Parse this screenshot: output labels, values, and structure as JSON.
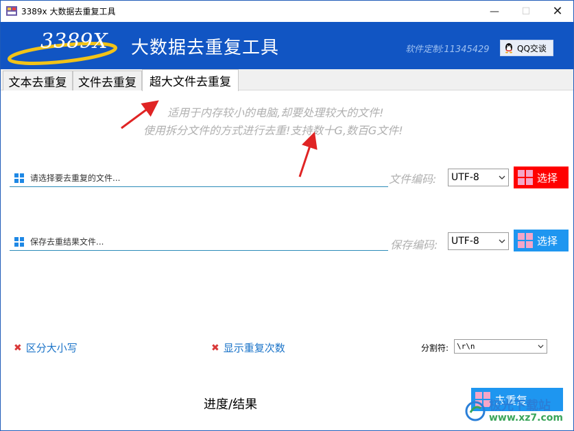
{
  "window": {
    "title": "3389x 大数据去重复工具",
    "minimize_glyph": "—",
    "maximize_glyph": "☐",
    "close_glyph": "✕"
  },
  "header": {
    "logo_text": "3389X",
    "app_title": "大数据去重复工具",
    "custom_text": "软件定制:11345429",
    "qq_button": "QQ交谈"
  },
  "tabs": [
    {
      "label": "文本去重复",
      "active": false
    },
    {
      "label": "文件去重复",
      "active": false
    },
    {
      "label": "超大文件去重复",
      "active": true
    }
  ],
  "notice": {
    "line1": "适用于内存较小的电脑,却要处理较大的文件!",
    "line2": "使用拆分文件的方式进行去重!支持数十G,数百G文件!"
  },
  "source_file": {
    "placeholder": "请选择要去重复的文件...",
    "encoding_label": "文件编码:",
    "encoding_value": "UTF-8",
    "pick_button": "选择",
    "button_color": "#ff0000"
  },
  "output_file": {
    "placeholder": "保存去重结果文件...",
    "encoding_label": "保存编码:",
    "encoding_value": "UTF-8",
    "pick_button": "选择",
    "button_color": "#1e96f0"
  },
  "options": {
    "case_sensitive": "区分大小写",
    "show_repeat_count": "显示重复次数",
    "separator_label": "分割符:",
    "separator_value": "\\r\\n"
  },
  "footer": {
    "progress_label": "进度/结果",
    "dedup_button": "去重复"
  },
  "watermark": {
    "line1": "极光下载站",
    "line2": "www.xz7.com"
  },
  "colors": {
    "banner": "#1155c3",
    "accent_blue": "#1e96f0",
    "link_blue": "#1a73c8",
    "red_button": "#ff0000",
    "hint_gray": "#b0b0b0"
  }
}
